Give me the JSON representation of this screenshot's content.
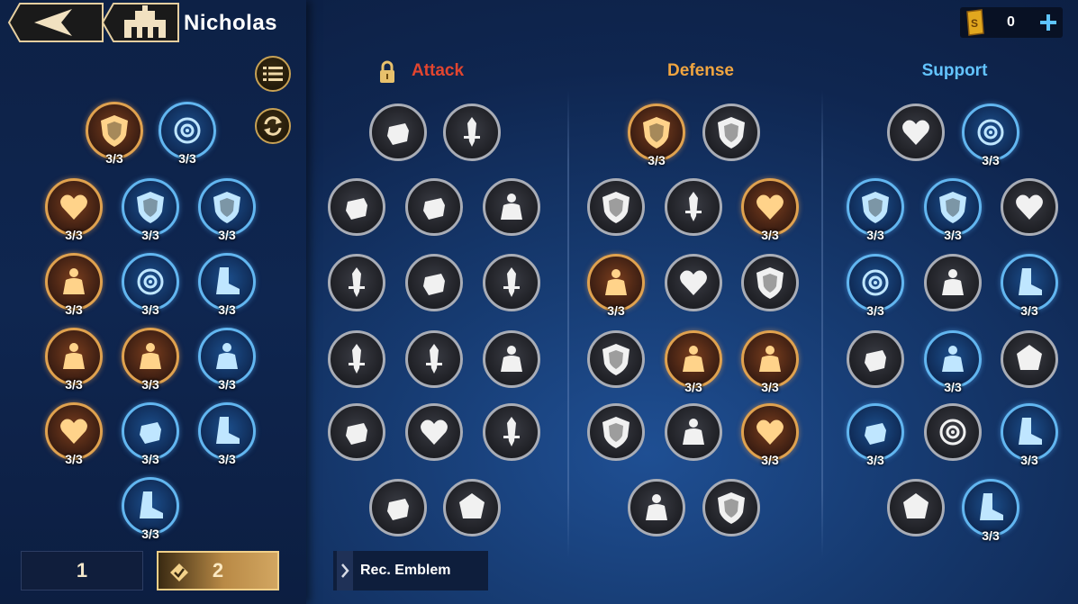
{
  "header": {
    "hero_name": "Nicholas"
  },
  "currency": {
    "value": "0",
    "icon": "scroll-coin-icon",
    "add_icon": "plus-icon"
  },
  "left_buttons": {
    "list_icon": "list-icon",
    "swap_icon": "swap-icon"
  },
  "columns": {
    "attack": "Attack",
    "defense": "Defense",
    "support": "Support"
  },
  "pages": {
    "page1": "1",
    "page2": "2"
  },
  "rec_label": "Rec. Emblem",
  "count": "3/3",
  "colors": {
    "attack": "#e2452f",
    "defense": "#f0a540",
    "support": "#63c4ff"
  }
}
